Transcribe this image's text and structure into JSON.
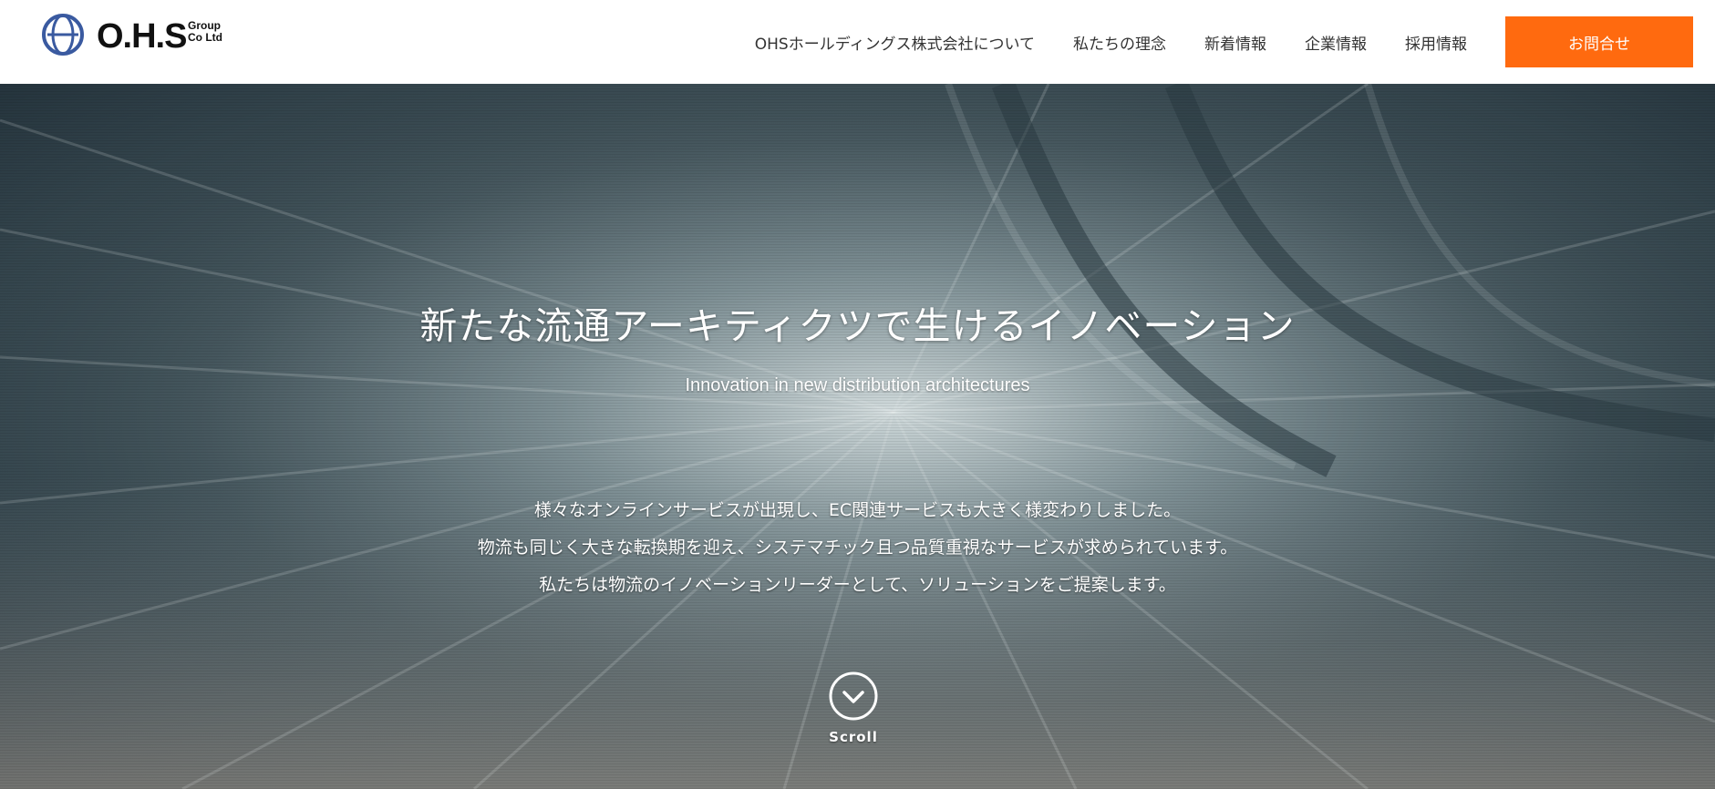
{
  "header": {
    "logo": {
      "name": "O.H.S",
      "group_line1": "Group",
      "group_line2": "Co Ltd"
    },
    "nav": [
      {
        "label": "OHSホールディングス株式会社について"
      },
      {
        "label": "私たちの理念"
      },
      {
        "label": "新着情報"
      },
      {
        "label": "企業情報"
      },
      {
        "label": "採用情報"
      }
    ],
    "contact_label": "お問合せ"
  },
  "hero": {
    "title": "新たな流通アーキティクツで生けるイノベーション",
    "subtitle": "Innovation in new distribution architectures",
    "body": [
      "様々なオンラインサービスが出現し、EC関連サービスも大きく様変わりしました。",
      "物流も同じく大きな転換期を迎え、システマチック且つ品質重視なサービスが求められています。",
      "私たちは物流のイノベーションリーダーとして、ソリューションをご提案します。"
    ],
    "scroll_label": "Scroll"
  },
  "colors": {
    "accent": "#ff6a0f",
    "logo_blue": "#3a5aa0"
  },
  "icons": {
    "logo": "ohs-logo-mark",
    "scroll": "chevron-down-circle-icon"
  }
}
